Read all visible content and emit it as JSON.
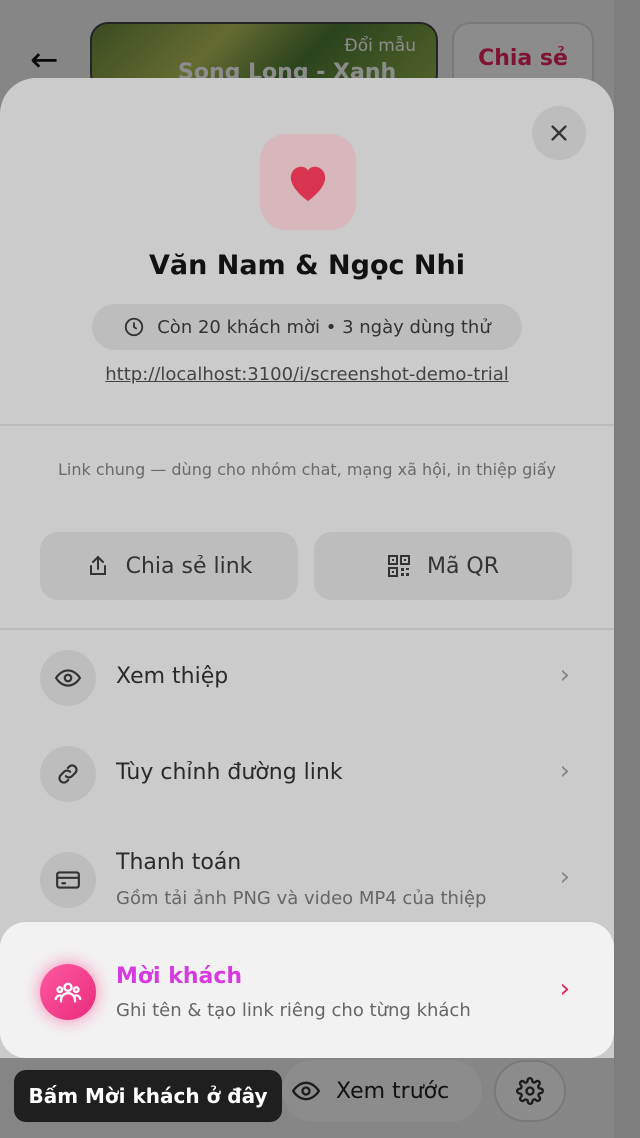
{
  "top_bar": {
    "template_hint": "Đổi mẫu",
    "template_name": "Song Long - Xanh",
    "share_label": "Chia sẻ"
  },
  "sheet": {
    "title": "Văn Nam & Ngọc Nhi",
    "trial_status": "Còn 20 khách mời • 3 ngày dùng thử",
    "invite_url": "http://localhost:3100/i/screenshot-demo-trial",
    "share_note": "Link chung — dùng cho nhóm chat, mạng xã hội, in thiệp giấy",
    "buttons": {
      "share_link": "Chia sẻ link",
      "qr_code": "Mã QR"
    },
    "rows": [
      {
        "label": "Xem thiệp",
        "icon": "eye-icon"
      },
      {
        "label": "Tùy chỉnh đường link",
        "icon": "link-icon"
      },
      {
        "label": "Thanh toán",
        "sub": "Gồm tải ảnh PNG và video MP4 của thiệp",
        "icon": "credit-card-icon"
      },
      {
        "label": "Mời khách",
        "sub": "Ghi tên & tạo link riêng cho từng khách",
        "icon": "users-icon"
      }
    ]
  },
  "bottom_bar": {
    "preview_label": "Xem trước"
  },
  "tooltip": "Bấm Mời khách ở đây",
  "colors": {
    "accent": "#e5255c",
    "invite_title": "#d63be0",
    "heart": "#e0345f"
  }
}
